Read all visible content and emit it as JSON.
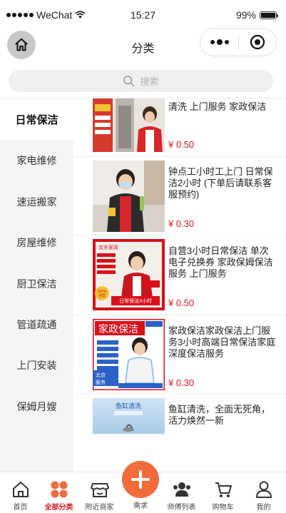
{
  "status_bar": {
    "carrier": "WeChat",
    "time": "15:27",
    "battery": "99%",
    "battery_level": 0.99
  },
  "nav": {
    "title": "分类",
    "home_icon": "home-icon",
    "more_icon": "more-dots-icon",
    "close_icon": "target-close-icon"
  },
  "search": {
    "placeholder": "搜索"
  },
  "sidebar": {
    "items": [
      {
        "label": "日常保洁",
        "active": true
      },
      {
        "label": "家电维修"
      },
      {
        "label": "速运搬家"
      },
      {
        "label": "房屋维修"
      },
      {
        "label": "厨卫保洁"
      },
      {
        "label": "管道疏通"
      },
      {
        "label": "上门安装"
      },
      {
        "label": "保姆月嫂"
      }
    ]
  },
  "products": [
    {
      "title": "清洗 上门服务 家政保洁",
      "price": "¥ 0.50"
    },
    {
      "title": "钟点工小时工上门 日常保洁2小时 (下单后请联系客服预约)",
      "price": "¥ 0.30"
    },
    {
      "title": "自营3小时日常保洁 单次电子兑换券 家政保姆保洁服务 上门服务",
      "price": "¥ 0.50",
      "img_text": {
        "brand": "京东家政",
        "badge_top": "100%",
        "badge_bottom": "自营",
        "banner": "日常保洁3小时"
      }
    },
    {
      "title": "家政保洁家政保洁上门服务3小时高端日常保洁家庭深度保洁服务",
      "price": "¥ 0.30",
      "img_text": {
        "heading": "家政保洁",
        "city": "北京",
        "service": "服务"
      }
    },
    {
      "title": "鱼缸清洗，全面无死角，活力焕然一新",
      "price": "",
      "img_text": {
        "heading": "鱼缸清洗"
      }
    }
  ],
  "tabbar": {
    "items": [
      {
        "label": "首页",
        "icon": "home-icon"
      },
      {
        "label": "全部分类",
        "icon": "grid-dots-icon",
        "active": true
      },
      {
        "label": "附近商家",
        "icon": "store-icon"
      },
      {
        "label": "需求",
        "icon": "plus-icon"
      },
      {
        "label": "师傅列表",
        "icon": "people-icon"
      },
      {
        "label": "购物车",
        "icon": "cart-icon"
      },
      {
        "label": "我的",
        "icon": "user-icon"
      }
    ],
    "accent": "#e0161e",
    "fab_color": "#f26b3a"
  }
}
